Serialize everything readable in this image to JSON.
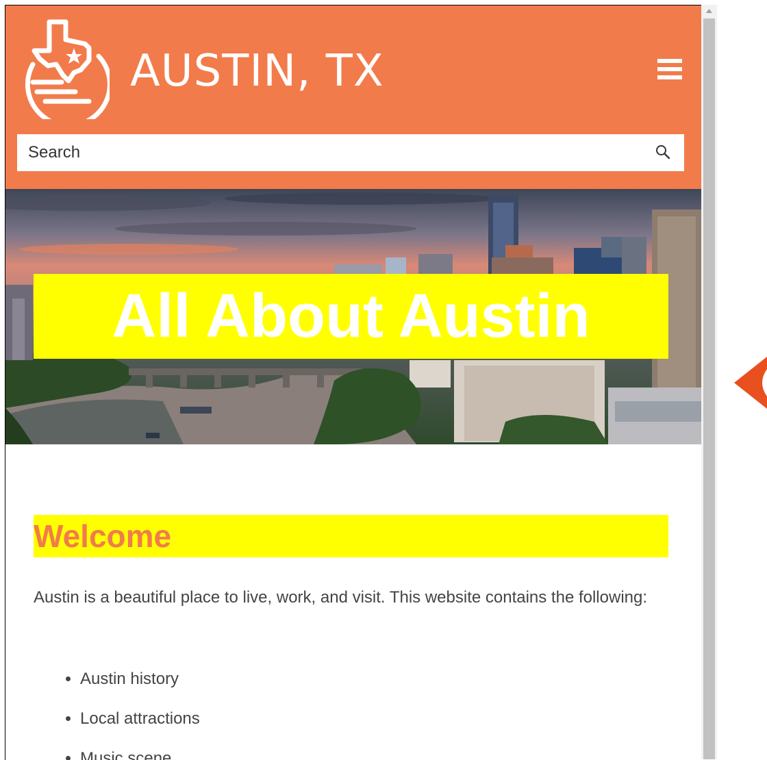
{
  "header": {
    "site_title": "AUSTIN, TX",
    "logo_icon": "texas-star-logo",
    "menu_icon": "hamburger-menu-icon",
    "bg_color": "#f27b4b"
  },
  "search": {
    "placeholder": "Search",
    "icon": "search-icon"
  },
  "hero": {
    "title": "All About Austin",
    "highlight_color": "#ffff00"
  },
  "main": {
    "heading": "Welcome",
    "intro": "Austin is a beautiful place to live, work, and visit. This website contains the following:",
    "list_items": [
      "Austin history",
      "Local attractions",
      "Music scene"
    ]
  },
  "callout": {
    "icon": "callout-arrow-icon",
    "color": "#e8501f"
  }
}
